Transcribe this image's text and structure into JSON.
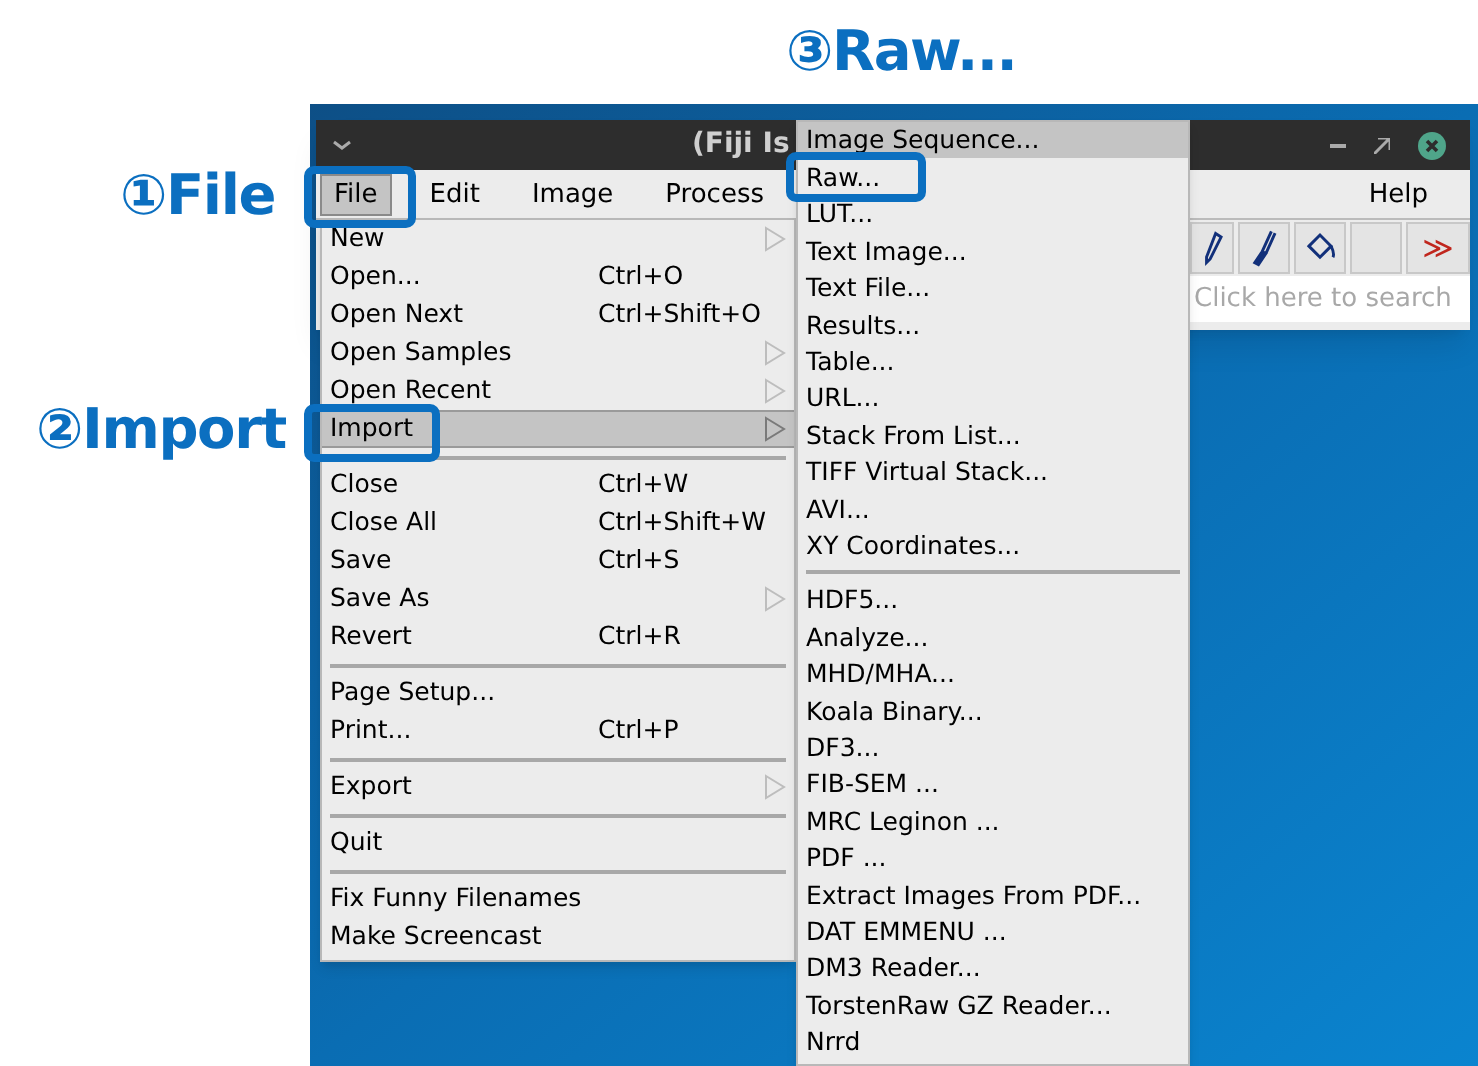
{
  "annotations": [
    {
      "label": "③Raw..."
    },
    {
      "label": "①File"
    },
    {
      "label": "②Import"
    }
  ],
  "window": {
    "title": "(Fiji Is"
  },
  "menubar": [
    {
      "label": "File",
      "selected": true
    },
    {
      "label": "Edit",
      "selected": false
    },
    {
      "label": "Image",
      "selected": false
    },
    {
      "label": "Process",
      "selected": false
    },
    {
      "label": "Help",
      "selected": false
    }
  ],
  "toolbar": {
    "more": "≫"
  },
  "search": {
    "placeholder": "Click here to search"
  },
  "file_menu": [
    {
      "kind": "item",
      "label": "New",
      "submenu": true,
      "selected": false
    },
    {
      "kind": "item",
      "label": "Open...",
      "shortcut": "Ctrl+O",
      "submenu": false,
      "selected": false
    },
    {
      "kind": "item",
      "label": "Open Next",
      "shortcut": "Ctrl+Shift+O",
      "submenu": false,
      "selected": false
    },
    {
      "kind": "item",
      "label": "Open Samples",
      "submenu": true,
      "selected": false
    },
    {
      "kind": "item",
      "label": "Open Recent",
      "submenu": true,
      "selected": false
    },
    {
      "kind": "item",
      "label": "Import",
      "submenu": true,
      "selected": true
    },
    {
      "kind": "separator"
    },
    {
      "kind": "item",
      "label": "Close",
      "shortcut": "Ctrl+W",
      "submenu": false,
      "selected": false
    },
    {
      "kind": "item",
      "label": "Close All",
      "shortcut": "Ctrl+Shift+W",
      "submenu": false,
      "selected": false
    },
    {
      "kind": "item",
      "label": "Save",
      "shortcut": "Ctrl+S",
      "submenu": false,
      "selected": false
    },
    {
      "kind": "item",
      "label": "Save As",
      "submenu": true,
      "selected": false
    },
    {
      "kind": "item",
      "label": "Revert",
      "shortcut": "Ctrl+R",
      "submenu": false,
      "selected": false
    },
    {
      "kind": "separator"
    },
    {
      "kind": "item",
      "label": "Page Setup...",
      "submenu": false,
      "selected": false
    },
    {
      "kind": "item",
      "label": "Print...",
      "shortcut": "Ctrl+P",
      "submenu": false,
      "selected": false
    },
    {
      "kind": "separator"
    },
    {
      "kind": "item",
      "label": "Export",
      "submenu": true,
      "selected": false
    },
    {
      "kind": "separator"
    },
    {
      "kind": "item",
      "label": "Quit",
      "submenu": false,
      "selected": false
    },
    {
      "kind": "separator"
    },
    {
      "kind": "item",
      "label": "Fix Funny Filenames",
      "submenu": false,
      "selected": false
    },
    {
      "kind": "item",
      "label": "Make Screencast",
      "submenu": false,
      "selected": false
    }
  ],
  "import_submenu": [
    {
      "kind": "item",
      "label": "Image Sequence...",
      "selected": true
    },
    {
      "kind": "item",
      "label": "Raw...",
      "selected": false
    },
    {
      "kind": "item",
      "label": "LUT...",
      "selected": false
    },
    {
      "kind": "item",
      "label": "Text Image...",
      "selected": false
    },
    {
      "kind": "item",
      "label": "Text File...",
      "selected": false
    },
    {
      "kind": "item",
      "label": "Results...",
      "selected": false
    },
    {
      "kind": "item",
      "label": "Table...",
      "selected": false
    },
    {
      "kind": "item",
      "label": "URL...",
      "selected": false
    },
    {
      "kind": "item",
      "label": "Stack From List...",
      "selected": false
    },
    {
      "kind": "item",
      "label": "TIFF Virtual Stack...",
      "selected": false
    },
    {
      "kind": "item",
      "label": "AVI...",
      "selected": false
    },
    {
      "kind": "item",
      "label": "XY Coordinates...",
      "selected": false
    },
    {
      "kind": "separator"
    },
    {
      "kind": "item",
      "label": "HDF5...",
      "selected": false
    },
    {
      "kind": "item",
      "label": "Analyze...",
      "selected": false
    },
    {
      "kind": "item",
      "label": "MHD/MHA...",
      "selected": false
    },
    {
      "kind": "item",
      "label": "Koala Binary...",
      "selected": false
    },
    {
      "kind": "item",
      "label": "DF3...",
      "selected": false
    },
    {
      "kind": "item",
      "label": "FIB-SEM ...",
      "selected": false
    },
    {
      "kind": "item",
      "label": "MRC Leginon ...",
      "selected": false
    },
    {
      "kind": "item",
      "label": "PDF ...",
      "selected": false
    },
    {
      "kind": "item",
      "label": "Extract Images From PDF...",
      "selected": false
    },
    {
      "kind": "item",
      "label": "DAT EMMENU ...",
      "selected": false
    },
    {
      "kind": "item",
      "label": "DM3 Reader...",
      "selected": false
    },
    {
      "kind": "item",
      "label": "TorstenRaw GZ Reader...",
      "selected": false
    },
    {
      "kind": "item",
      "label": "Nrrd",
      "selected": false
    }
  ]
}
